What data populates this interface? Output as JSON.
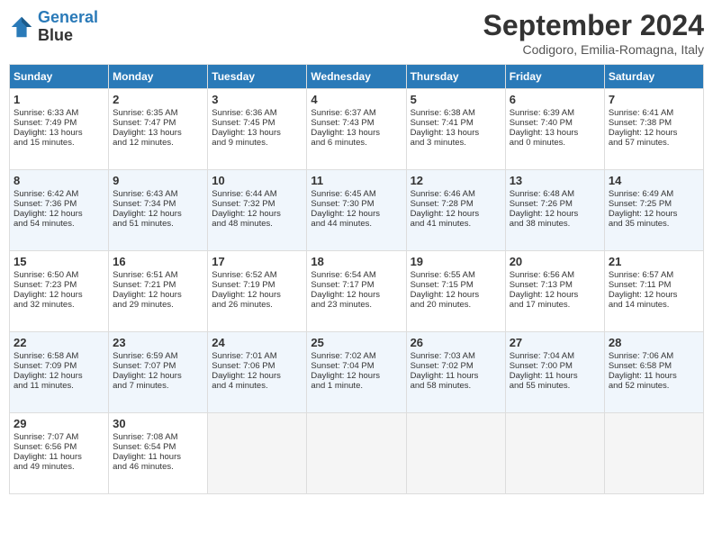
{
  "header": {
    "logo_line1": "General",
    "logo_line2": "Blue",
    "month": "September 2024",
    "location": "Codigoro, Emilia-Romagna, Italy"
  },
  "days_of_week": [
    "Sunday",
    "Monday",
    "Tuesday",
    "Wednesday",
    "Thursday",
    "Friday",
    "Saturday"
  ],
  "weeks": [
    [
      {
        "day": "1",
        "lines": [
          "Sunrise: 6:33 AM",
          "Sunset: 7:49 PM",
          "Daylight: 13 hours",
          "and 15 minutes."
        ]
      },
      {
        "day": "2",
        "lines": [
          "Sunrise: 6:35 AM",
          "Sunset: 7:47 PM",
          "Daylight: 13 hours",
          "and 12 minutes."
        ]
      },
      {
        "day": "3",
        "lines": [
          "Sunrise: 6:36 AM",
          "Sunset: 7:45 PM",
          "Daylight: 13 hours",
          "and 9 minutes."
        ]
      },
      {
        "day": "4",
        "lines": [
          "Sunrise: 6:37 AM",
          "Sunset: 7:43 PM",
          "Daylight: 13 hours",
          "and 6 minutes."
        ]
      },
      {
        "day": "5",
        "lines": [
          "Sunrise: 6:38 AM",
          "Sunset: 7:41 PM",
          "Daylight: 13 hours",
          "and 3 minutes."
        ]
      },
      {
        "day": "6",
        "lines": [
          "Sunrise: 6:39 AM",
          "Sunset: 7:40 PM",
          "Daylight: 13 hours",
          "and 0 minutes."
        ]
      },
      {
        "day": "7",
        "lines": [
          "Sunrise: 6:41 AM",
          "Sunset: 7:38 PM",
          "Daylight: 12 hours",
          "and 57 minutes."
        ]
      }
    ],
    [
      {
        "day": "8",
        "lines": [
          "Sunrise: 6:42 AM",
          "Sunset: 7:36 PM",
          "Daylight: 12 hours",
          "and 54 minutes."
        ]
      },
      {
        "day": "9",
        "lines": [
          "Sunrise: 6:43 AM",
          "Sunset: 7:34 PM",
          "Daylight: 12 hours",
          "and 51 minutes."
        ]
      },
      {
        "day": "10",
        "lines": [
          "Sunrise: 6:44 AM",
          "Sunset: 7:32 PM",
          "Daylight: 12 hours",
          "and 48 minutes."
        ]
      },
      {
        "day": "11",
        "lines": [
          "Sunrise: 6:45 AM",
          "Sunset: 7:30 PM",
          "Daylight: 12 hours",
          "and 44 minutes."
        ]
      },
      {
        "day": "12",
        "lines": [
          "Sunrise: 6:46 AM",
          "Sunset: 7:28 PM",
          "Daylight: 12 hours",
          "and 41 minutes."
        ]
      },
      {
        "day": "13",
        "lines": [
          "Sunrise: 6:48 AM",
          "Sunset: 7:26 PM",
          "Daylight: 12 hours",
          "and 38 minutes."
        ]
      },
      {
        "day": "14",
        "lines": [
          "Sunrise: 6:49 AM",
          "Sunset: 7:25 PM",
          "Daylight: 12 hours",
          "and 35 minutes."
        ]
      }
    ],
    [
      {
        "day": "15",
        "lines": [
          "Sunrise: 6:50 AM",
          "Sunset: 7:23 PM",
          "Daylight: 12 hours",
          "and 32 minutes."
        ]
      },
      {
        "day": "16",
        "lines": [
          "Sunrise: 6:51 AM",
          "Sunset: 7:21 PM",
          "Daylight: 12 hours",
          "and 29 minutes."
        ]
      },
      {
        "day": "17",
        "lines": [
          "Sunrise: 6:52 AM",
          "Sunset: 7:19 PM",
          "Daylight: 12 hours",
          "and 26 minutes."
        ]
      },
      {
        "day": "18",
        "lines": [
          "Sunrise: 6:54 AM",
          "Sunset: 7:17 PM",
          "Daylight: 12 hours",
          "and 23 minutes."
        ]
      },
      {
        "day": "19",
        "lines": [
          "Sunrise: 6:55 AM",
          "Sunset: 7:15 PM",
          "Daylight: 12 hours",
          "and 20 minutes."
        ]
      },
      {
        "day": "20",
        "lines": [
          "Sunrise: 6:56 AM",
          "Sunset: 7:13 PM",
          "Daylight: 12 hours",
          "and 17 minutes."
        ]
      },
      {
        "day": "21",
        "lines": [
          "Sunrise: 6:57 AM",
          "Sunset: 7:11 PM",
          "Daylight: 12 hours",
          "and 14 minutes."
        ]
      }
    ],
    [
      {
        "day": "22",
        "lines": [
          "Sunrise: 6:58 AM",
          "Sunset: 7:09 PM",
          "Daylight: 12 hours",
          "and 11 minutes."
        ]
      },
      {
        "day": "23",
        "lines": [
          "Sunrise: 6:59 AM",
          "Sunset: 7:07 PM",
          "Daylight: 12 hours",
          "and 7 minutes."
        ]
      },
      {
        "day": "24",
        "lines": [
          "Sunrise: 7:01 AM",
          "Sunset: 7:06 PM",
          "Daylight: 12 hours",
          "and 4 minutes."
        ]
      },
      {
        "day": "25",
        "lines": [
          "Sunrise: 7:02 AM",
          "Sunset: 7:04 PM",
          "Daylight: 12 hours",
          "and 1 minute."
        ]
      },
      {
        "day": "26",
        "lines": [
          "Sunrise: 7:03 AM",
          "Sunset: 7:02 PM",
          "Daylight: 11 hours",
          "and 58 minutes."
        ]
      },
      {
        "day": "27",
        "lines": [
          "Sunrise: 7:04 AM",
          "Sunset: 7:00 PM",
          "Daylight: 11 hours",
          "and 55 minutes."
        ]
      },
      {
        "day": "28",
        "lines": [
          "Sunrise: 7:06 AM",
          "Sunset: 6:58 PM",
          "Daylight: 11 hours",
          "and 52 minutes."
        ]
      }
    ],
    [
      {
        "day": "29",
        "lines": [
          "Sunrise: 7:07 AM",
          "Sunset: 6:56 PM",
          "Daylight: 11 hours",
          "and 49 minutes."
        ]
      },
      {
        "day": "30",
        "lines": [
          "Sunrise: 7:08 AM",
          "Sunset: 6:54 PM",
          "Daylight: 11 hours",
          "and 46 minutes."
        ]
      },
      {
        "day": "",
        "lines": []
      },
      {
        "day": "",
        "lines": []
      },
      {
        "day": "",
        "lines": []
      },
      {
        "day": "",
        "lines": []
      },
      {
        "day": "",
        "lines": []
      }
    ]
  ]
}
